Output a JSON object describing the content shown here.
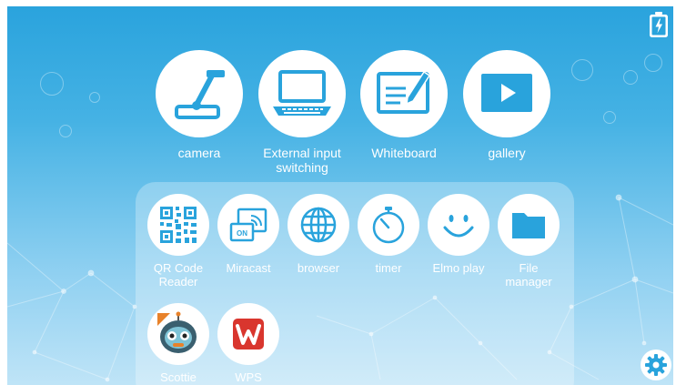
{
  "colors": {
    "accent": "#29a3dc",
    "background_top": "#2aa3dd",
    "background_bottom": "#bfe4f7",
    "label": "#ffffff",
    "wps_red": "#d9362e"
  },
  "status": {
    "battery_icon": "battery-charging-icon"
  },
  "main_apps": [
    {
      "label": "camera",
      "icon": "document-camera-icon"
    },
    {
      "label": "External input\nswitching",
      "icon": "laptop-icon"
    },
    {
      "label": "Whiteboard",
      "icon": "whiteboard-pen-icon"
    },
    {
      "label": "gallery",
      "icon": "play-icon"
    }
  ],
  "drawer_apps": [
    {
      "label": "QR Code\nReader",
      "icon": "qr-code-icon"
    },
    {
      "label": "Miracast",
      "icon": "cast-icon"
    },
    {
      "label": "browser",
      "icon": "globe-icon"
    },
    {
      "label": "timer",
      "icon": "stopwatch-icon"
    },
    {
      "label": "Elmo play",
      "icon": "smiley-icon"
    },
    {
      "label": "File\nmanager",
      "icon": "folder-icon"
    },
    {
      "label": "Scottie",
      "icon": "robot-icon"
    },
    {
      "label": "WPS",
      "icon": "wps-icon"
    }
  ],
  "settings": {
    "icon": "gear-icon"
  }
}
